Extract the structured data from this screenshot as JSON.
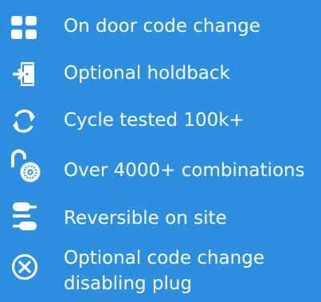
{
  "theme": {
    "background": "#2E8FE0",
    "text_color": "#FFFFFF"
  },
  "features": [
    {
      "icon": "keypad-grid-icon",
      "label": "On door code change"
    },
    {
      "icon": "door-exit-icon",
      "label": "Optional holdback"
    },
    {
      "icon": "cycle-arrows-icon",
      "label": "Cycle tested 100k+"
    },
    {
      "icon": "padlock-dial-icon",
      "label": "Over 4000+ combinations"
    },
    {
      "icon": "reversible-handle-icon",
      "label": "Reversible on site"
    },
    {
      "icon": "circle-x-icon",
      "label_line1": "Optional code change",
      "label_line2": "disabling plug"
    }
  ]
}
